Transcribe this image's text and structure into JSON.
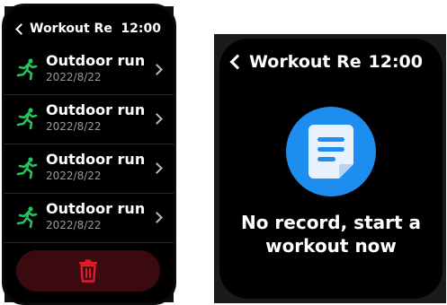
{
  "left_screen": {
    "title": "Workout Re",
    "time": "12:00",
    "records": [
      {
        "title": "Outdoor run",
        "date": "2022/8/22"
      },
      {
        "title": "Outdoor run",
        "date": "2022/8/22"
      },
      {
        "title": "Outdoor run",
        "date": "2022/8/22"
      },
      {
        "title": "Outdoor run",
        "date": "2022/8/22"
      }
    ],
    "icons": {
      "run": "running-person-icon",
      "chevron": "chevron-right-icon",
      "delete": "trash-icon"
    }
  },
  "right_screen": {
    "title": "Workout Re",
    "time": "12:00",
    "empty_message": "No record, start a workout now",
    "icons": {
      "empty": "document-icon"
    }
  },
  "colors": {
    "accent_green": "#22c55e",
    "delete_red": "#e11d2a",
    "delete_bg": "#3b0a10",
    "empty_icon_bg": "#1d8ef0"
  }
}
